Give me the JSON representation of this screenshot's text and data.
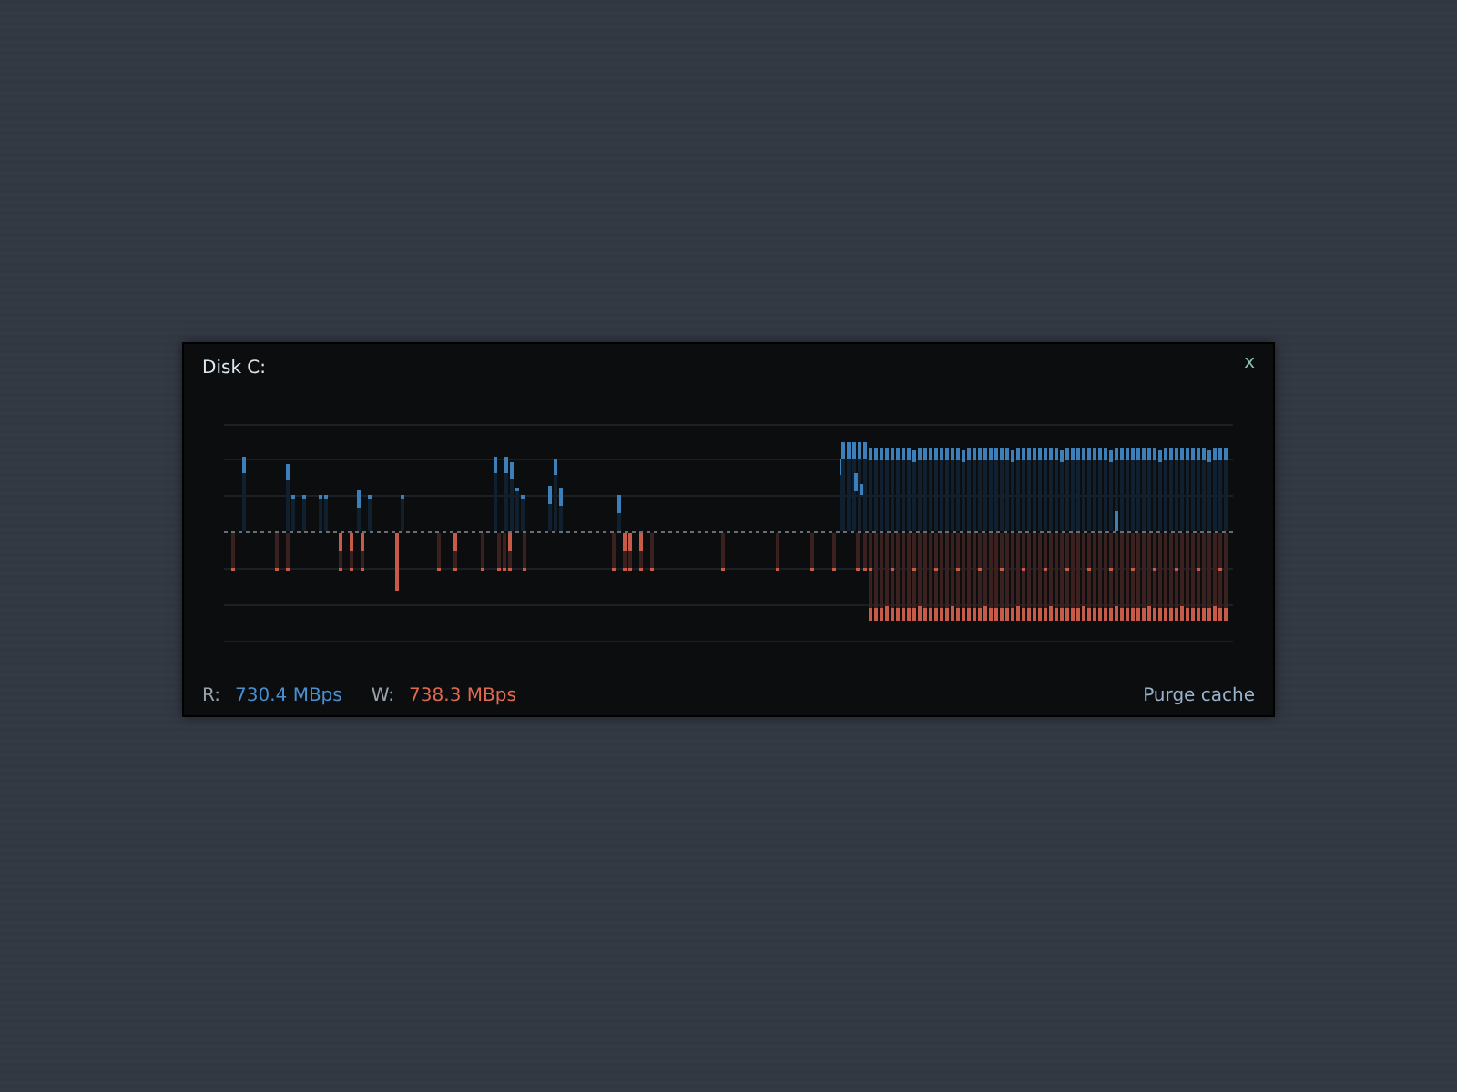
{
  "window": {
    "title": "Disk C:",
    "close": "x"
  },
  "stats": [
    {
      "label": "R:",
      "value": "730.4 MBps",
      "kind": "read"
    },
    {
      "label": "W:",
      "value": "738.3 MBps",
      "kind": "write"
    }
  ],
  "actions": [
    {
      "label": "Purge cache"
    }
  ]
}
